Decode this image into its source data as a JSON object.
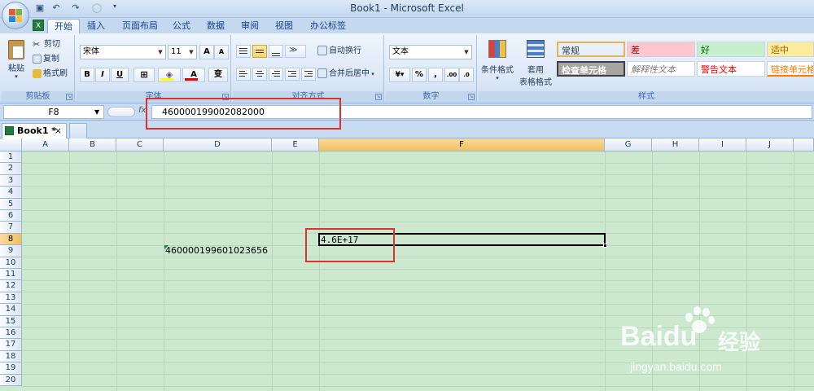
{
  "window": {
    "title": "Book1 - Microsoft Excel"
  },
  "ribbon_tabs": [
    "开始",
    "插入",
    "页面布局",
    "公式",
    "数据",
    "审阅",
    "视图",
    "办公标签"
  ],
  "clipboard": {
    "paste": "粘贴",
    "cut": "剪切",
    "copy": "复制",
    "format_painter": "格式刷",
    "label": "剪贴板"
  },
  "font": {
    "name": "宋体",
    "size": "11",
    "bold": "B",
    "italic": "I",
    "underline": "U",
    "grow": "A",
    "shrink": "A",
    "label": "字体"
  },
  "alignment": {
    "wrap": "自动换行",
    "merge": "合并后居中",
    "label": "对齐方式"
  },
  "number": {
    "format": "文本",
    "label": "数字"
  },
  "styles": {
    "conditional": "条件格式",
    "table1": "套用",
    "table2": "表格格式",
    "cells": [
      {
        "text": "常规",
        "color": "#000000",
        "bg": "#ffffff"
      },
      {
        "text": "差",
        "color": "#9c0006",
        "bg": "#ffc7ce"
      },
      {
        "text": "好",
        "color": "#006100",
        "bg": "#c6efce"
      },
      {
        "text": "适中",
        "color": "#9c6500",
        "bg": "#ffeb9c"
      },
      {
        "text": "检查单元格",
        "color": "#ffffff",
        "bg": "#a5a5a5"
      },
      {
        "text": "解释性文本",
        "color": "#7f7f7f",
        "bg": "#ffffff"
      },
      {
        "text": "警告文本",
        "color": "#ff0000",
        "bg": "#ffffff"
      },
      {
        "text": "链接单元格",
        "color": "#fa7d00",
        "bg": "#ffffff"
      }
    ],
    "label": "样式"
  },
  "formula_bar": {
    "name_box": "F8",
    "fx": "fx",
    "value": "460000199002082000"
  },
  "workbook_tab": {
    "name": "Book1 *"
  },
  "columns": [
    "A",
    "B",
    "C",
    "D",
    "E",
    "F",
    "G",
    "H",
    "I",
    "J"
  ],
  "rows": [
    "1",
    "2",
    "3",
    "4",
    "5",
    "6",
    "7",
    "8",
    "9",
    "10",
    "11",
    "12",
    "13",
    "14",
    "15",
    "16",
    "17",
    "18",
    "19",
    "20"
  ],
  "cells": {
    "D9": "460000199601023656",
    "F8": "4.6E+17"
  },
  "watermark": {
    "brand": "Baidu",
    "cn": "经验",
    "url": "jingyan.baidu.com"
  },
  "colors": {
    "grid_bg": "#cce8cf",
    "highlight": "#e0302e",
    "selected_header": "#f1c15f"
  }
}
